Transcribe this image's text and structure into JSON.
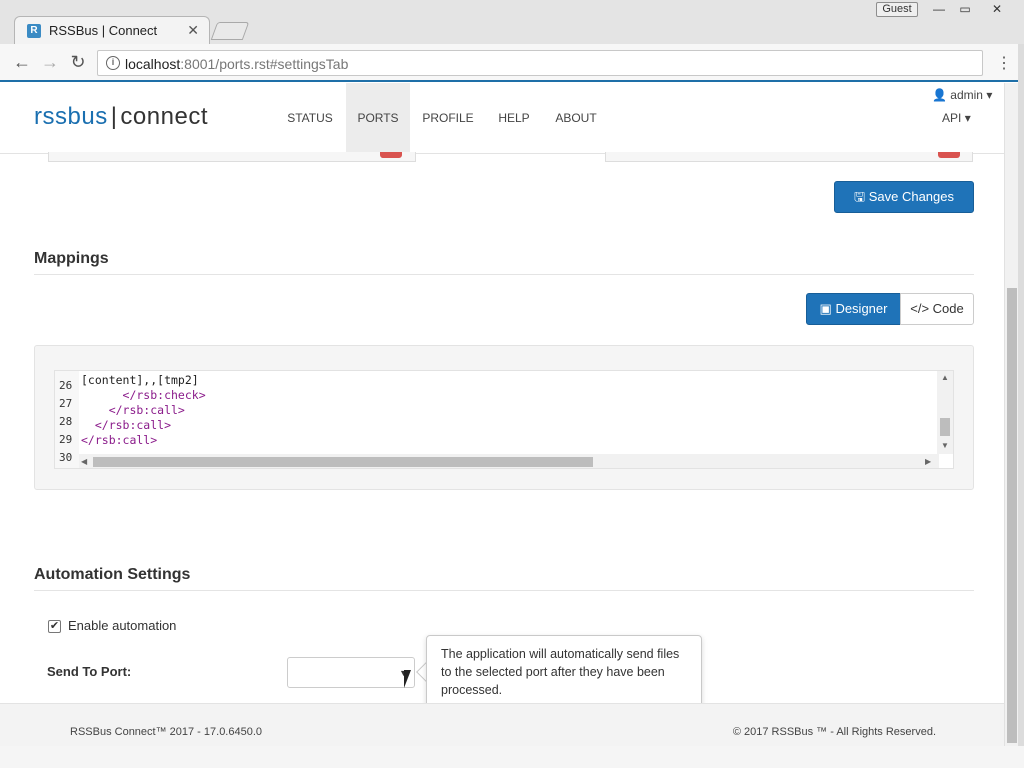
{
  "browser": {
    "tab_title": "RSSBus | Connect",
    "profile": "Guest",
    "url_host": "localhost",
    "url_rest": ":8001/ports.rst#settingsTab"
  },
  "header": {
    "logo_left": "rssbus",
    "logo_sep": "|",
    "logo_right": "connect",
    "nav": [
      "STATUS",
      "PORTS",
      "PROFILE",
      "HELP",
      "ABOUT"
    ],
    "active_nav": "PORTS",
    "user": "admin",
    "api": "API"
  },
  "toolbar": {
    "save_label": "Save Changes"
  },
  "mappings": {
    "title": "Mappings",
    "designer_label": "Designer",
    "code_label": "Code",
    "line_numbers": [
      "26",
      "27",
      "28",
      "29",
      "30"
    ],
    "code_lines": [
      "[content],,[tmp2]",
      "      </rsb:check>",
      "    </rsb:call>",
      "  </rsb:call>",
      "</rsb:call>"
    ]
  },
  "automation": {
    "title": "Automation Settings",
    "enable_label": "Enable automation",
    "enabled": true,
    "send_to_port_label": "Send To Port:",
    "send_to_port_value": "",
    "tooltip": "The application will automatically send files to the selected port after they have been processed."
  },
  "footer": {
    "left": "RSSBus Connect™ 2017 - 17.0.6450.0",
    "right": "© 2017 RSSBus ™ - All Rights Reserved."
  },
  "colors": {
    "primary": "#1f73b8",
    "logo_blue": "#1a6fb0",
    "danger": "#d9534f"
  }
}
